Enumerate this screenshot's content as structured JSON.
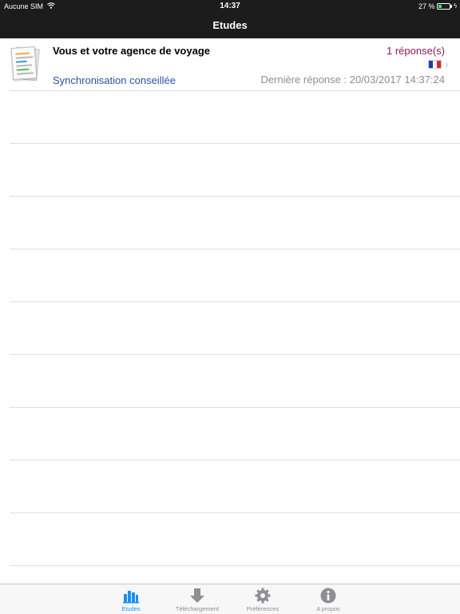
{
  "status_bar": {
    "carrier": "Aucune SIM",
    "time": "14:37",
    "battery_percent_text": "27 %",
    "battery_level": 0.27
  },
  "nav": {
    "title": "Etudes"
  },
  "studies": [
    {
      "title": "Vous et votre agence de voyage",
      "responses": "1 réponse(s)",
      "sync_status": "Synchronisation conseillée",
      "last_response": "Dernière réponse : 20/03/2017 14:37:24",
      "language_flag": "flag-fr-icon"
    }
  ],
  "tabs": [
    {
      "label": "Etudes",
      "icon": "studies-bar-chart-icon",
      "active": true
    },
    {
      "label": "Téléchargement",
      "icon": "download-arrow-icon",
      "active": false
    },
    {
      "label": "Préférences",
      "icon": "gear-icon",
      "active": false
    },
    {
      "label": "A propos",
      "icon": "info-icon",
      "active": false
    }
  ],
  "colors": {
    "bar_background": "#1c1c1c",
    "accent": "#1f8ff0",
    "responses": "#8b1a5a",
    "sync_link": "#2b52a3",
    "secondary_text": "#8e8e93",
    "inactive_tab_icon": "#8e8e93"
  }
}
